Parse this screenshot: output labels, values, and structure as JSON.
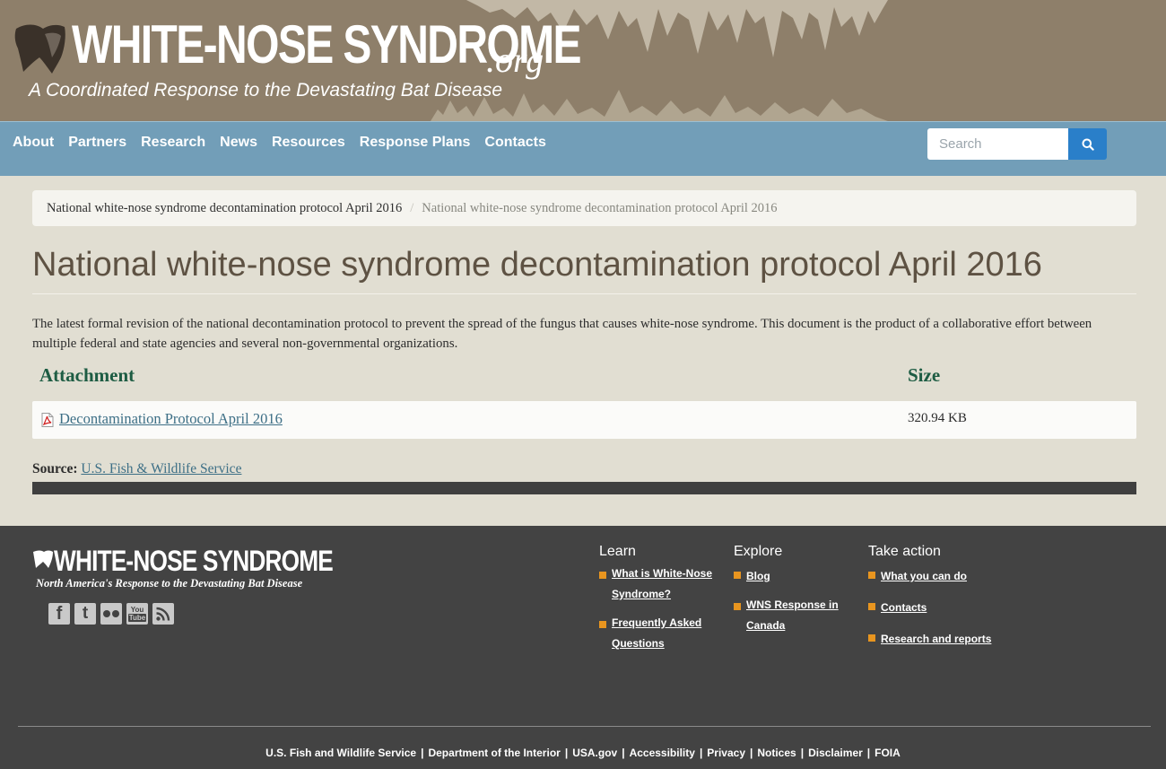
{
  "header": {
    "logo_title": "WHITE-NOSE SYNDROME",
    "logo_suffix": ".org",
    "tagline": "A Coordinated Response to the Devastating Bat Disease"
  },
  "nav": {
    "items": [
      "About",
      "Partners",
      "Research",
      "News",
      "Resources",
      "Response Plans",
      "Contacts"
    ],
    "search_placeholder": "Search",
    "search_icon": "search-icon"
  },
  "breadcrumb": {
    "parent": "National white-nose syndrome decontamination protocol April 2016",
    "current": "National white-nose syndrome decontamination protocol April 2016"
  },
  "main": {
    "title": "National white-nose syndrome decontamination protocol April 2016",
    "description": "The latest formal revision of the national decontamination protocol to prevent the spread of the fungus that causes white-nose syndrome. This document is the product of a collaborative effort between multiple federal and state agencies and several non-governmental organizations.",
    "attachments": {
      "headers": [
        "Attachment",
        "Size"
      ],
      "rows": [
        {
          "name": "Decontamination Protocol April 2016",
          "size": "320.94 KB",
          "icon": "pdf-icon"
        }
      ]
    },
    "source_label": "Source:",
    "source_link": "U.S. Fish & Wildlife Service"
  },
  "footer": {
    "logo_title": "WHITE-NOSE SYNDROME",
    "tagline": "North America's Response to the Devastating Bat Disease",
    "social_icons": [
      "facebook-icon",
      "twitter-icon",
      "flickr-icon",
      "youtube-icon",
      "rss-icon"
    ],
    "social_labels": {
      "facebook": "f",
      "twitter": "t",
      "youtube_top": "You",
      "youtube_bottom": "Tube"
    },
    "columns": [
      {
        "heading": "Learn",
        "links": [
          "What is White-Nose Syndrome?",
          "Frequently Asked Questions"
        ]
      },
      {
        "heading": "Explore",
        "links": [
          "Blog",
          "WNS Response in Canada"
        ]
      },
      {
        "heading": "Take action",
        "links": [
          "What you can do",
          "Contacts",
          "Research and reports"
        ]
      }
    ],
    "bottom_links": [
      "U.S. Fish and Wildlife Service",
      "Department of the Interior",
      "USA.gov",
      "Accessibility",
      "Privacy",
      "Notices",
      "Disclaimer",
      "FOIA"
    ],
    "bottom_separator": "|"
  },
  "colors": {
    "header_bg": "#8e7f6a",
    "nav_bg": "#729eb8",
    "page_bg": "#e1ded2",
    "title_text": "#5e5243",
    "table_header": "#1d5c43",
    "link": "#3d6f86",
    "search_button": "#2a7fc9",
    "footer_bg": "#434343",
    "footer_bullet": "#e8951f"
  }
}
